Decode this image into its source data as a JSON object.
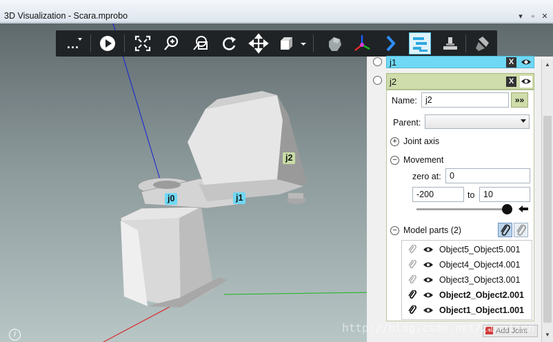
{
  "window": {
    "title": "3D Visualization - Scara.mprobo",
    "pin_glyph": "▾",
    "restore_glyph": "▫",
    "close_glyph": "✕"
  },
  "toolbar": {
    "items": [
      {
        "name": "more-icon"
      },
      {
        "name": "play-icon"
      },
      {
        "name": "fit-view-icon"
      },
      {
        "name": "zoom-icon"
      },
      {
        "name": "zoom-window-icon"
      },
      {
        "name": "rotate-icon"
      },
      {
        "name": "pan-icon"
      },
      {
        "name": "view-cube-icon"
      },
      {
        "name": "shape-icon"
      },
      {
        "name": "axes-icon"
      },
      {
        "name": "chevron-right-icon"
      },
      {
        "name": "joints-panel-icon"
      },
      {
        "name": "import-icon"
      },
      {
        "name": "tool-icon"
      }
    ],
    "more_label": "...",
    "active_color": "#5bc8ee"
  },
  "scene": {
    "joint_tags": [
      {
        "label": "j0",
        "color": "#6fd8f4"
      },
      {
        "label": "j1",
        "color": "#6fd8f4"
      },
      {
        "label": "j2",
        "color": "#c8dca6"
      }
    ]
  },
  "joints_panel": {
    "joint_j1": {
      "label": "j1",
      "color": "#6fd8f4"
    },
    "joint_j2": {
      "label": "j2",
      "color": "#cfdcab",
      "name_label": "Name:",
      "name_value": "j2",
      "apply_glyph": "»»",
      "parent_label": "Parent:",
      "parent_value": "",
      "joint_axis_label": "Joint axis",
      "movement_label": "Movement",
      "zero_at_label": "zero at:",
      "zero_at_value": "0",
      "min_value": "-200",
      "to_label": "to",
      "max_value": "10",
      "slider_position": 1.0,
      "model_parts_label": "Model parts (2)",
      "parts": [
        {
          "name": "Object5_Object5.001",
          "attached": false
        },
        {
          "name": "Object4_Object4.001",
          "attached": false
        },
        {
          "name": "Object3_Object3.001",
          "attached": false
        },
        {
          "name": "Object2_Object2.001",
          "attached": true
        },
        {
          "name": "Object1_Object1.001",
          "attached": true
        }
      ]
    },
    "x_glyph": "X",
    "add_joint_label": "Add Joint"
  },
  "watermark": "http://blog.csdn.net/zimotion",
  "info_glyph": "i"
}
